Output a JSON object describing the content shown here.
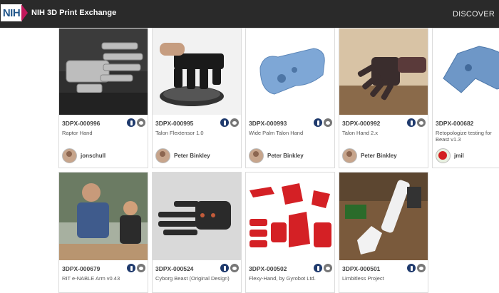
{
  "header": {
    "logo_text": "NIH",
    "site_title": "NIH 3D Print Exchange",
    "nav_discover": "DISCOVER"
  },
  "colors": {
    "topbar": "#2a2a2a",
    "nih_blue": "#20558a",
    "nih_chevron": "#c2185b"
  },
  "cards": [
    {
      "id": "3DPX-000996",
      "name": "Raptor Hand",
      "author": "jonschull",
      "badges": [
        "nih-icon",
        "comment-icon"
      ]
    },
    {
      "id": "3DPX-000995",
      "name": "Talon Flextensor 1.0",
      "author": "Peter Binkley",
      "badges": [
        "nih-icon",
        "comment-icon"
      ]
    },
    {
      "id": "3DPX-000993",
      "name": "Wide Palm Talon Hand",
      "author": "Peter Binkley",
      "badges": [
        "nih-icon",
        "comment-icon"
      ]
    },
    {
      "id": "3DPX-000992",
      "name": "Talon Hand 2.x",
      "author": "Peter Binkley",
      "badges": [
        "nih-icon",
        "comment-icon"
      ]
    },
    {
      "id": "3DPX-000682",
      "name": "Retopologize testing for Beast v1.3",
      "author": "jmil",
      "badges": [
        "nih-icon",
        "comment-icon"
      ]
    },
    {
      "id": "3DPX-000679",
      "name": "RIT e-NABLE Arm v0.43",
      "author": "",
      "badges": [
        "nih-icon",
        "comment-icon"
      ]
    },
    {
      "id": "3DPX-000524",
      "name": "Cyborg Beast (Original Design)",
      "author": "",
      "badges": [
        "nih-icon",
        "comment-icon"
      ]
    },
    {
      "id": "3DPX-000502",
      "name": "Flexy-Hand, by Gyrobot Ltd.",
      "author": "",
      "badges": [
        "nih-icon",
        "comment-icon"
      ]
    },
    {
      "id": "3DPX-000501",
      "name": "Limbitless Project",
      "author": "",
      "badges": [
        "nih-icon",
        "comment-icon"
      ]
    }
  ]
}
